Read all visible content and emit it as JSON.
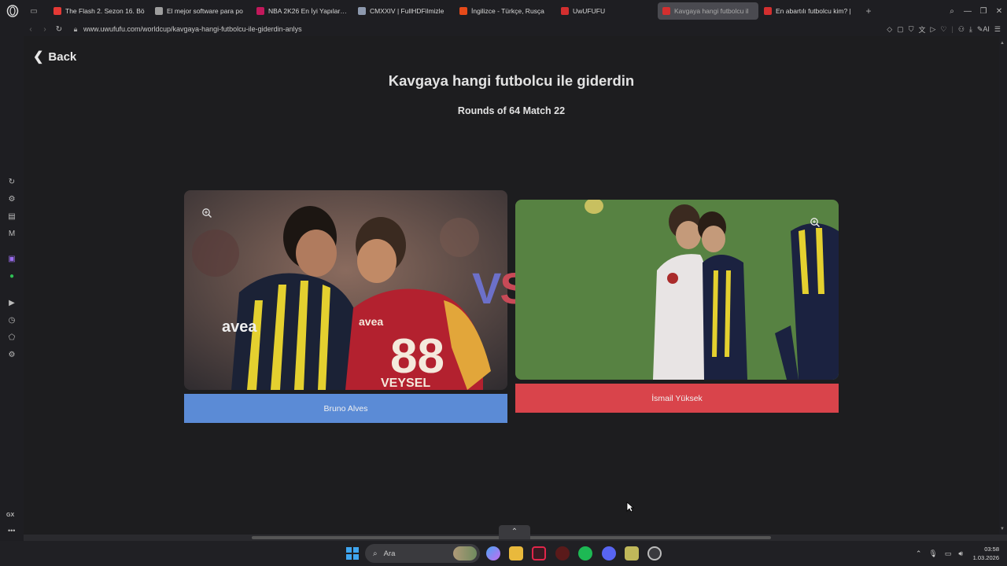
{
  "browser": {
    "tabs": [
      {
        "label": "The Flash 2. Sezon 16. Bö",
        "fav_color": "#e53935",
        "active": false
      },
      {
        "label": "El mejor software para po",
        "fav_color": "#9e9e9e",
        "active": false
      },
      {
        "label": "NBA 2K26 En İyi Yapılar: P",
        "fav_color": "#c2185b",
        "active": false
      },
      {
        "label": "CMXXIV | FullHDFilmizle",
        "fav_color": "#8d99ae",
        "active": false
      },
      {
        "label": "İngilizce - Türkçe, Rusça",
        "fav_color": "#e64a19",
        "active": false
      },
      {
        "label": "UwUFUFU",
        "fav_color": "#d32f2f",
        "active": false
      },
      {
        "label": "Kavgaya hangi futbolcu il",
        "fav_color": "#d32f2f",
        "active": true
      },
      {
        "label": "En abartılı futbolcu kim? |",
        "fav_color": "#d32f2f",
        "active": false
      }
    ],
    "url": "www.uwufufu.com/worldcup/kavgaya-hangi-futbolcu-ile-giderdin-anlys"
  },
  "page": {
    "back_label": "Back",
    "title": "Kavgaya hangi futbolcu ile giderdin",
    "round_info": "Rounds of 64 Match 22",
    "vs_text": {
      "v": "V",
      "s": "S"
    },
    "left_choice": {
      "name": "Bruno Alves",
      "button_color": "#5b8bd6"
    },
    "right_choice": {
      "name": "İsmail Yüksek",
      "button_color": "#d9444b"
    }
  },
  "taskbar": {
    "search_placeholder": "Ara",
    "time": "03:58",
    "date": "1.03.2026"
  }
}
